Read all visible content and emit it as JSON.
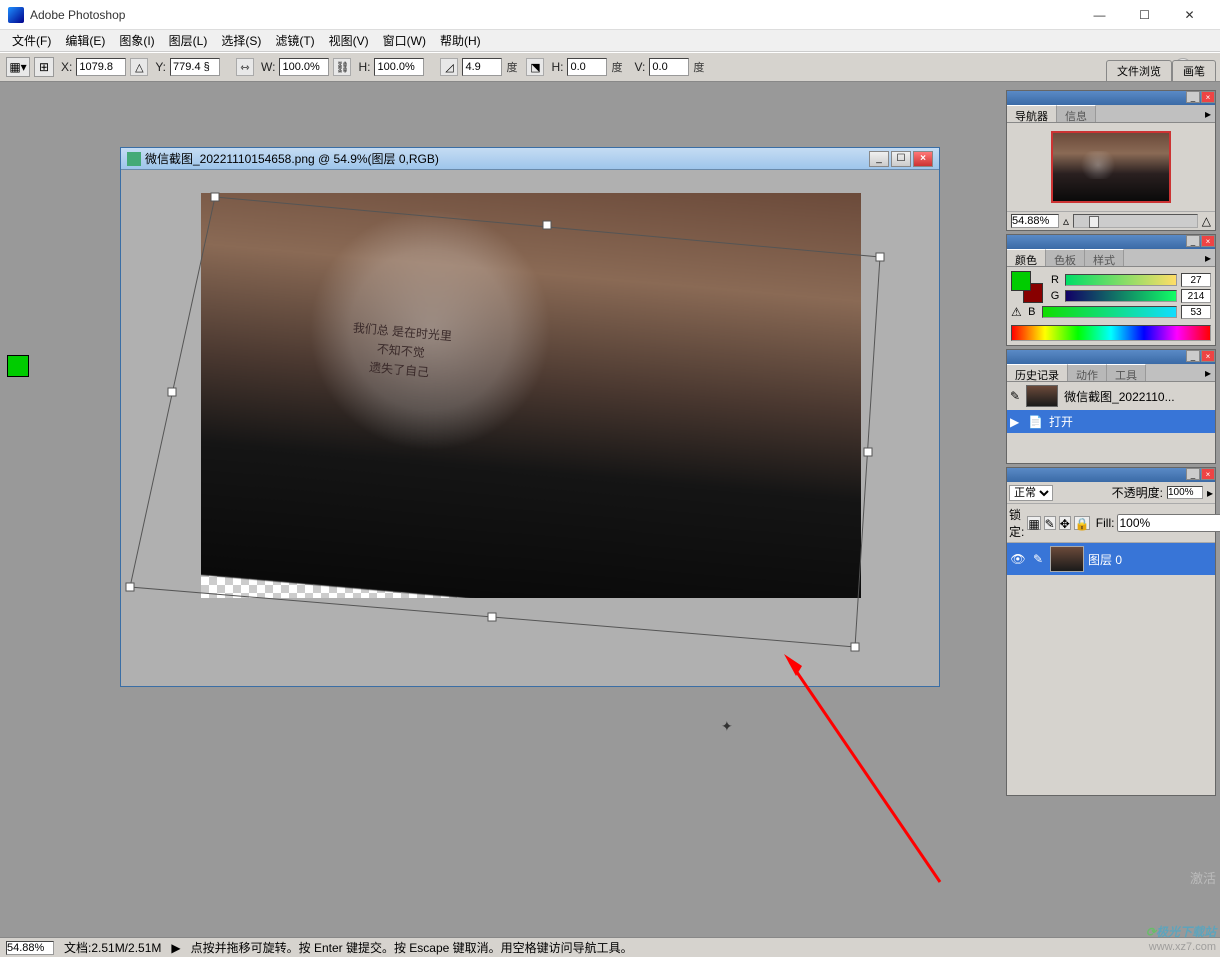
{
  "title": "Adobe Photoshop",
  "menu": [
    "文件(F)",
    "编辑(E)",
    "图象(I)",
    "图层(L)",
    "选择(S)",
    "滤镜(T)",
    "视图(V)",
    "窗口(W)",
    "帮助(H)"
  ],
  "opt": {
    "x_lbl": "X:",
    "x": "1079.8",
    "y_lbl": "Y:",
    "y": "779.4 §",
    "w_lbl": "W:",
    "w": "100.0%",
    "h_lbl": "H:",
    "h": "100.0%",
    "a_lbl": "",
    "a": "4.9",
    "a_unit": "度",
    "dh_lbl": "H:",
    "dh": "0.0",
    "dh_unit": "度",
    "dv_lbl": "V:",
    "dv": "0.0",
    "dv_unit": "度"
  },
  "tabwell": [
    "文件浏览",
    "画笔"
  ],
  "doc": {
    "title": "微信截图_20221110154658.png @ 54.9%(图层 0,RGB)",
    "poem_l1": "我们总 是在时光里",
    "poem_l2": "不知不觉",
    "poem_l3": "遗失了自己"
  },
  "nav": {
    "tabs": [
      "导航器",
      "信息"
    ],
    "zoom": "54.88%"
  },
  "color": {
    "tabs": [
      "颜色",
      "色板",
      "样式"
    ],
    "r_lbl": "R",
    "r": "27",
    "g_lbl": "G",
    "g": "214",
    "b_lbl": "B",
    "b": "53"
  },
  "history": {
    "tabs": [
      "历史记录",
      "动作",
      "工具"
    ],
    "filename": "微信截图_2022110...",
    "action": "打开"
  },
  "layers": {
    "mode": "正常",
    "opacity_lbl": "不透明度:",
    "opacity": "100%",
    "lock_lbl": "锁定:",
    "fill_lbl": "Fill:",
    "fill": "100%",
    "layer0": "图层 0"
  },
  "status": {
    "zoom": "54.88%",
    "docinfo": "文档:2.51M/2.51M",
    "hint": "点按并拖移可旋转。按 Enter 键提交。按 Escape 键取消。用空格键访问导航工具。"
  },
  "watermark": "极光下载站",
  "watermark_url": "www.xz7.com",
  "watermark2": "激活"
}
